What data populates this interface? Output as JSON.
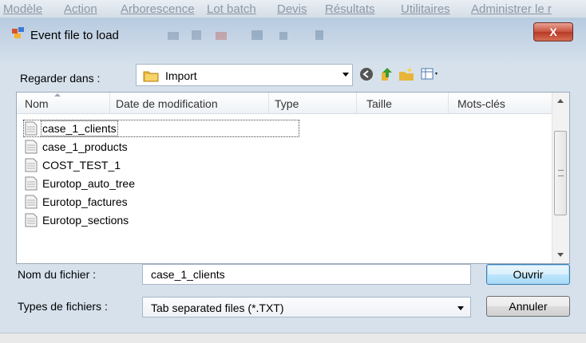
{
  "app_menu": [
    "Modèle",
    "Action",
    "Arborescence",
    "Lot batch",
    "Devis",
    "Résultats",
    "Utilitaires",
    "Administrer le r"
  ],
  "dialog": {
    "title": "Event file to load",
    "close_label": "X"
  },
  "look_in": {
    "label": "Regarder dans :",
    "value": "Import"
  },
  "columns": [
    "Nom",
    "Date de modification",
    "Type",
    "Taille",
    "Mots-clés"
  ],
  "files": [
    {
      "name": "case_1_clients"
    },
    {
      "name": "case_1_products"
    },
    {
      "name": "COST_TEST_1"
    },
    {
      "name": "Eurotop_auto_tree"
    },
    {
      "name": "Eurotop_factures"
    },
    {
      "name": "Eurotop_sections"
    }
  ],
  "selected_file_index": 0,
  "filename": {
    "label": "Nom du fichier :",
    "value": "case_1_clients"
  },
  "filetype": {
    "label": "Types de fichiers :",
    "value": "Tab separated files (*.TXT)"
  },
  "buttons": {
    "open": "Ouvrir",
    "cancel": "Annuler"
  },
  "colors": {
    "close_button": "#c9503c",
    "default_button": "#a7d9f5"
  }
}
